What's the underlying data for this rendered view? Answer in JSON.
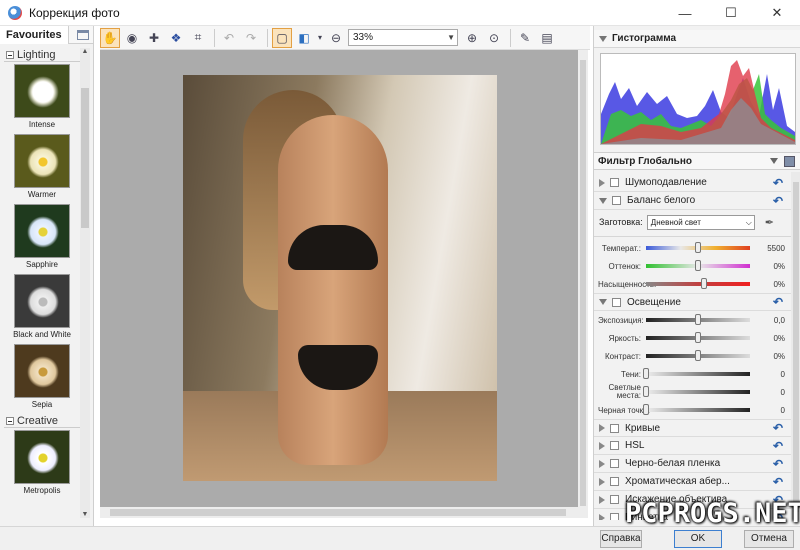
{
  "window": {
    "title": "Коррекция фото",
    "controls": {
      "minimize": "—",
      "maximize": "☐",
      "close": "✕"
    }
  },
  "favourites": {
    "tab_label": "Favourites",
    "categories": [
      {
        "name": "Lighting",
        "presets": [
          "Intense",
          "Warmer",
          "Sapphire",
          "Black and White",
          "Sepia"
        ]
      },
      {
        "name": "Creative",
        "presets": [
          "Metropolis"
        ]
      }
    ]
  },
  "toolbar": {
    "zoom": "33%"
  },
  "histogram": {
    "title": "Гистограмма"
  },
  "filters": {
    "header": "Фильтр Глобально",
    "noise": "Шумоподавление",
    "white_balance": {
      "label": "Баланс белого",
      "preset_label": "Заготовка:",
      "preset_value": "Дневной свет",
      "params": [
        {
          "label": "Температ.:",
          "value": "5500",
          "pos": 0.5
        },
        {
          "label": "Оттенок:",
          "value": "0%",
          "pos": 0.5
        },
        {
          "label": "Насыщенность:",
          "value": "0%",
          "pos": 0.56
        }
      ]
    },
    "lighting": {
      "label": "Освещение",
      "params": [
        {
          "label": "Экспозиция:",
          "value": "0,0",
          "pos": 0.5
        },
        {
          "label": "Яркость:",
          "value": "0%",
          "pos": 0.5
        },
        {
          "label": "Контраст:",
          "value": "0%",
          "pos": 0.5
        },
        {
          "label": "Тени:",
          "value": "0",
          "pos": 0.0
        },
        {
          "label": "Светлые места:",
          "value": "0",
          "pos": 0.0
        },
        {
          "label": "Черная точка:",
          "value": "0",
          "pos": 0.0
        }
      ]
    },
    "others": [
      "Кривые",
      "HSL",
      "Черно-белая пленка",
      "Хроматическая абер...",
      "Искажение объектива",
      "Виньетка"
    ]
  },
  "buttons": {
    "help": "Справка",
    "ok": "OK",
    "cancel": "Отмена"
  },
  "watermark": "PCPROGS.NET"
}
